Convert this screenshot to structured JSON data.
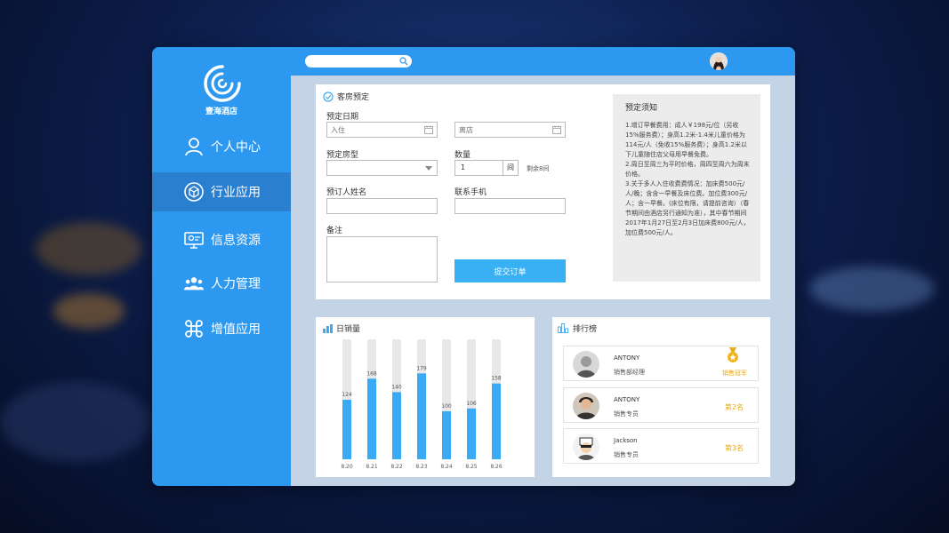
{
  "app": {
    "logo_text": "壹海酒店"
  },
  "nav": [
    {
      "label": "个人中心",
      "icon": "user-icon"
    },
    {
      "label": "行业应用",
      "icon": "cube-icon",
      "active": true
    },
    {
      "label": "信息资源",
      "icon": "monitor-icon"
    },
    {
      "label": "人力管理",
      "icon": "group-icon"
    },
    {
      "label": "增值应用",
      "icon": "command-icon"
    }
  ],
  "topbar": {
    "search_placeholder": ""
  },
  "booking": {
    "title": "客房预定",
    "date_label": "预定日期",
    "checkin_placeholder": "入住",
    "checkout_placeholder": "离店",
    "room_type_label": "预定房型",
    "quantity_label": "数量",
    "quantity_value": "1",
    "quantity_unit": "间",
    "remaining": "剩余8间",
    "name_label": "预订人姓名",
    "phone_label": "联系手机",
    "remark_label": "备注",
    "submit_label": "提交订单"
  },
  "notice": {
    "title": "预定须知",
    "body": "1.增订早餐费用：成人￥198元/位（另收15%服务费）；身高1.2米-1.4米儿童价格为114元/人（免收15%服务费）；身高1.2米以下儿童随住店父母用早餐免费。\n2.周日至周三为平时价格，周四至周六为周末价格。\n3.关于多人入住收费费情况：加床费500元/人/晚；含含一早餐及床位费。加位费300元/人；含一早餐。(床位有限，请提前咨询）（春节期间由酒店另行通知为准），其中春节期间2017年1月27日至2月3日加床费800元/人，加位费500元/人。"
  },
  "sales": {
    "title": "日销量"
  },
  "chart_data": {
    "type": "bar",
    "categories": [
      "8.20",
      "8.21",
      "8.22",
      "8.23",
      "8.24",
      "8.25",
      "8.26"
    ],
    "values": [
      124,
      168,
      140,
      179,
      100,
      106,
      158
    ],
    "ylim": [
      0,
      250
    ],
    "colors": {
      "bar": "#3aaaf5",
      "track": "#e8e8e8",
      "label": "#555555"
    }
  },
  "ranking": {
    "title": "排行榜",
    "items": [
      {
        "name": "ANTONY",
        "role": "销售部经理",
        "badge": "销售冠军"
      },
      {
        "name": "ANTONY",
        "role": "销售专员",
        "badge": "第2名"
      },
      {
        "name": "Jackson",
        "role": "销售专员",
        "badge": "第3名"
      }
    ]
  }
}
